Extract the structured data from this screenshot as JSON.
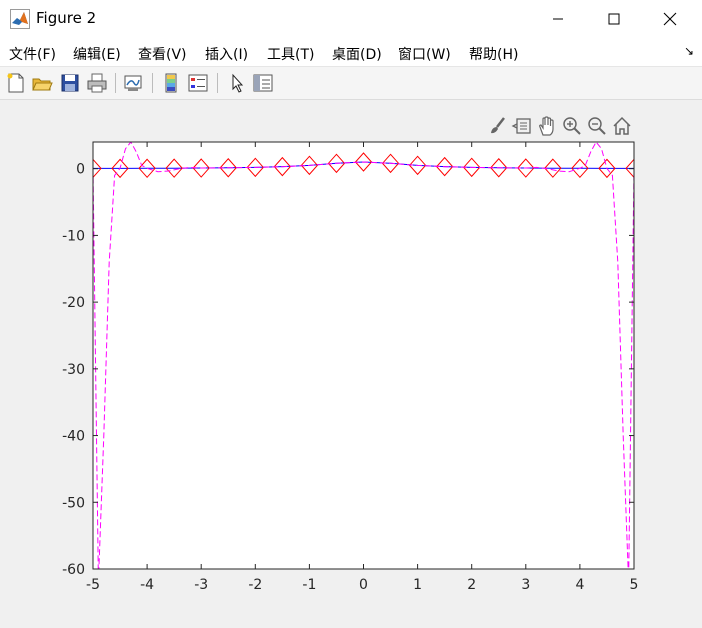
{
  "window": {
    "title": "Figure 2"
  },
  "menu": {
    "items": [
      "文件(F)",
      "编辑(E)",
      "查看(V)",
      "插入(I)",
      "工具(T)",
      "桌面(D)",
      "窗口(W)",
      "帮助(H)"
    ]
  },
  "toolbar": {
    "icons": [
      "new-figure-icon",
      "open-icon",
      "save-icon",
      "print-icon",
      "link-plot-icon",
      "insert-colorbar-icon",
      "insert-legend-icon",
      "edit-plot-arrow-icon",
      "property-inspector-icon"
    ]
  },
  "axes_toolbar": {
    "icons": [
      "brush-icon",
      "data-tips-icon",
      "pan-hand-icon",
      "zoom-in-icon",
      "zoom-out-icon",
      "home-icon"
    ]
  },
  "chart_data": {
    "type": "line",
    "title": "",
    "xlabel": "",
    "ylabel": "",
    "xlim": [
      -5,
      5
    ],
    "ylim": [
      -60,
      4
    ],
    "xticks": [
      -5,
      -4,
      -3,
      -2,
      -1,
      0,
      1,
      2,
      3,
      4,
      5
    ],
    "yticks": [
      -60,
      -50,
      -40,
      -30,
      -20,
      -10,
      0
    ],
    "grid": false,
    "legend": "none",
    "series": [
      {
        "style": "solid-line",
        "color": "#0000ff",
        "x": [
          -5,
          -4.5,
          -4,
          -3.5,
          -3,
          -2.5,
          -2,
          -1.5,
          -1,
          -0.5,
          0,
          0.5,
          1,
          1.5,
          2,
          2.5,
          3,
          3.5,
          4,
          4.5,
          5
        ],
        "y": [
          0.0385,
          0.0471,
          0.0588,
          0.0755,
          0.1,
          0.1379,
          0.2,
          0.3077,
          0.5,
          0.8,
          1.0,
          0.8,
          0.5,
          0.3077,
          0.2,
          0.1379,
          0.1,
          0.0755,
          0.0588,
          0.0471,
          0.0385
        ]
      },
      {
        "style": "diamond-markers",
        "color": "#ff0000",
        "x": [
          -5,
          -4.5,
          -4,
          -3.5,
          -3,
          -2.5,
          -2,
          -1.5,
          -1,
          -0.5,
          0,
          0.5,
          1,
          1.5,
          2,
          2.5,
          3,
          3.5,
          4,
          4.5,
          5
        ],
        "y": [
          0.0385,
          0.0471,
          0.0588,
          0.0755,
          0.1,
          0.1379,
          0.2,
          0.3077,
          0.5,
          0.8,
          1.0,
          0.8,
          0.5,
          0.3077,
          0.2,
          0.1379,
          0.1,
          0.0755,
          0.0588,
          0.0471,
          0.0385
        ]
      },
      {
        "style": "dashed-line",
        "color": "#ff00ff",
        "x": [
          -5,
          -4.9,
          -4.8,
          -4.7,
          -4.6,
          -4.5,
          -4.4,
          -4.3,
          -4.2,
          -4.1,
          -4.0,
          -3.8,
          -3.6,
          -3.4,
          -3.2,
          -3.0,
          -2.5,
          -2.0,
          -1.5,
          -1.0,
          -0.5,
          0,
          0.5,
          1.0,
          1.5,
          2.0,
          2.5,
          3.0,
          3.2,
          3.4,
          3.6,
          3.8,
          4.0,
          4.1,
          4.2,
          4.3,
          4.4,
          4.5,
          4.6,
          4.7,
          4.8,
          4.9,
          5
        ],
        "y": [
          0.04,
          -62,
          -40,
          -14,
          -1,
          0.05,
          3,
          4,
          2.5,
          0.5,
          0.06,
          -0.45,
          -0.35,
          0,
          0.2,
          0.1,
          0.14,
          0.2,
          0.3,
          0.5,
          0.8,
          1.0,
          0.8,
          0.5,
          0.3,
          0.2,
          0.14,
          0.1,
          0.2,
          0,
          -0.35,
          -0.45,
          0.06,
          0.5,
          2.5,
          4,
          3,
          0.05,
          -1,
          -14,
          -40,
          -62,
          0.04
        ]
      }
    ]
  }
}
